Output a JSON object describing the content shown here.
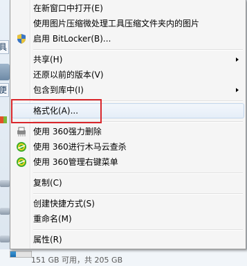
{
  "background": {
    "left_tabs": [
      "具",
      "便"
    ],
    "status": "151 GB 可用，共 205 GB",
    "disk_usage_fraction": 0.26
  },
  "menu": {
    "items": [
      {
        "label": "在新窗口中打开(E)"
      },
      {
        "label": "使用图片压缩微处理工具压缩文件夹内的图片"
      },
      {
        "label": "启用 BitLocker(B)...",
        "icon": "uac-shield-icon"
      },
      {
        "label": "共享(H)",
        "submenu": true
      },
      {
        "label": "还原以前的版本(V)"
      },
      {
        "label": "包含到库中(I)",
        "submenu": true
      },
      {
        "label": "格式化(A)...",
        "highlighted": true
      },
      {
        "label": "使用 360强力删除",
        "icon": "shredder-icon"
      },
      {
        "label": "使用 360进行木马云查杀",
        "icon": "360-green-icon"
      },
      {
        "label": "使用 360管理右键菜单",
        "icon": "360-green-icon"
      },
      {
        "label": "复制(C)"
      },
      {
        "label": "创建快捷方式(S)"
      },
      {
        "label": "重命名(M)"
      },
      {
        "label": "属性(R)"
      }
    ]
  },
  "annotation": {
    "color": "#d9262b"
  }
}
